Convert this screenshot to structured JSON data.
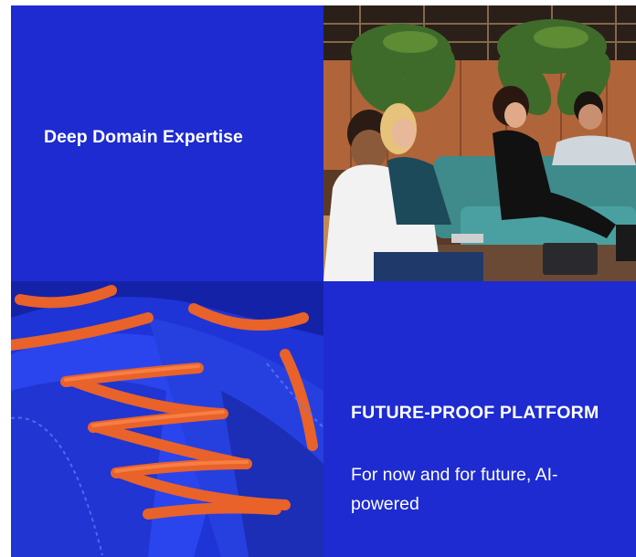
{
  "cards": {
    "domain": {
      "title": "Deep Domain Expertise"
    },
    "platform": {
      "title": "FUTURE-PROOF PLATFORM",
      "subtitle": "For now and for future, AI-powered"
    }
  },
  "images": {
    "team_photo": "people-meeting-lounge-image",
    "shoe_photo": "blue-shoe-orange-laces-image"
  },
  "colors": {
    "brand_blue": "#1d2bd0",
    "lace_orange": "#e8622a"
  }
}
